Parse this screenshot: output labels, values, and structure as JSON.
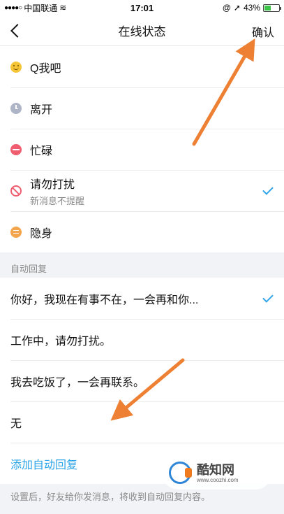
{
  "status_bar": {
    "carrier": "中国联通",
    "time": "17:01",
    "battery_percent": "43%",
    "battery_level": 0.43
  },
  "nav": {
    "title": "在线状态",
    "confirm_label": "确认"
  },
  "statuses": [
    {
      "label": "Q我吧",
      "icon": "smile-icon",
      "color": "#f7c638"
    },
    {
      "label": "离开",
      "icon": "clock-icon",
      "color": "#aeb5c6"
    },
    {
      "label": "忙碌",
      "icon": "minus-icon",
      "color": "#ef5d6f"
    },
    {
      "label": "请勿打扰",
      "sublabel": "新消息不提醒",
      "icon": "no-entry-icon",
      "color": "#ef5d6f",
      "selected": true
    },
    {
      "label": "隐身",
      "icon": "hidden-icon",
      "color": "#f3a54b"
    }
  ],
  "auto_reply": {
    "section_title": "自动回复",
    "options": [
      {
        "text": "你好，我现在有事不在，一会再和你...",
        "selected": true
      },
      {
        "text": "工作中，请勿打扰。"
      },
      {
        "text": "我去吃饭了，一会再联系。"
      },
      {
        "text": "无"
      }
    ],
    "add_label": "添加自动回复",
    "footnote": "设置后，好友给你发消息，将收到自动回复内容。"
  },
  "watermark": {
    "name": "酷知网",
    "url": "www.coozhi.com"
  },
  "colors": {
    "accent": "#2da5e8",
    "arrow": "#ee8033"
  }
}
